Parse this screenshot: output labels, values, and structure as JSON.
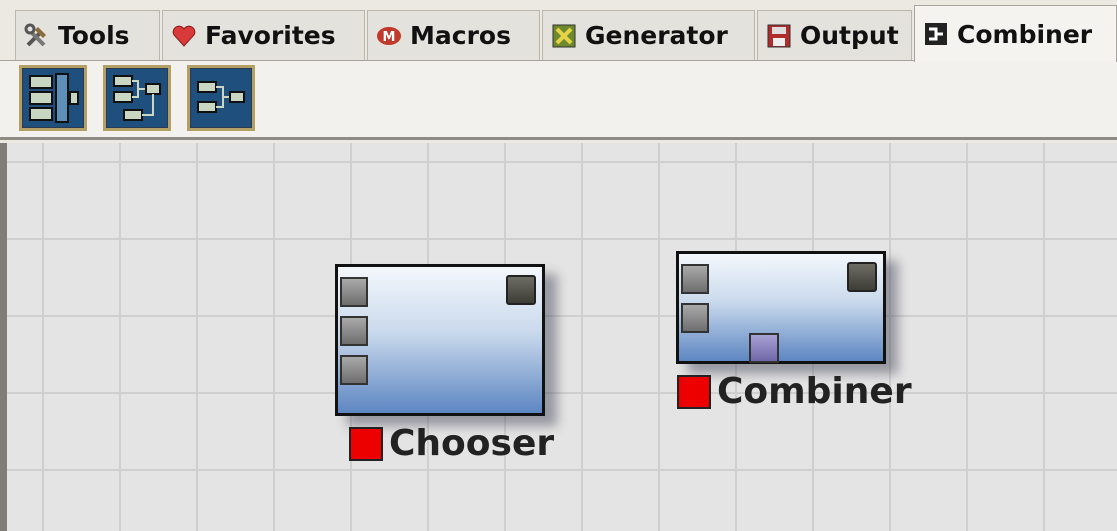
{
  "tabs": [
    {
      "label": "Tools",
      "icon": "tools-icon",
      "active": false
    },
    {
      "label": "Favorites",
      "icon": "heart-icon",
      "active": false
    },
    {
      "label": "Macros",
      "icon": "macros-icon",
      "active": false
    },
    {
      "label": "Generator",
      "icon": "generator-icon",
      "active": false
    },
    {
      "label": "Output",
      "icon": "output-icon",
      "active": false
    },
    {
      "label": "Combiner",
      "icon": "combiner-icon",
      "active": true
    }
  ],
  "toolbar": {
    "buttons": [
      {
        "icon": "add-chooser-icon"
      },
      {
        "icon": "add-combiner-tree-icon"
      },
      {
        "icon": "add-combiner-icon"
      }
    ]
  },
  "nodes": [
    {
      "label": "Chooser",
      "inputs": 3,
      "outputs": 1,
      "status_color": "#ec0000"
    },
    {
      "label": "Combiner",
      "inputs": 2,
      "outputs": 1,
      "bottom_port": true,
      "status_color": "#ec0000"
    }
  ],
  "colors": {
    "node_gradient_top": "#f4f8fc",
    "node_gradient_bottom": "#5d86c2",
    "status_red": "#ec0000",
    "toolbar_button_bg": "#1f4f7d",
    "toolbar_button_border": "#b4a064"
  }
}
